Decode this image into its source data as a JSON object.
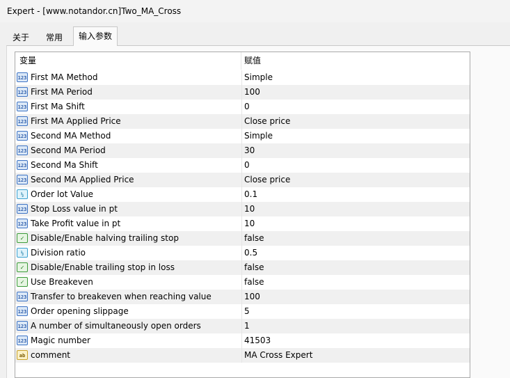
{
  "window": {
    "title": "Expert - [www.notandor.cn]Two_MA_Cross"
  },
  "tabs": [
    {
      "label": "关于",
      "active": false
    },
    {
      "label": "常用",
      "active": false
    },
    {
      "label": "输入参数",
      "active": true
    }
  ],
  "grid": {
    "headers": {
      "variable": "变量",
      "value": "赋值"
    },
    "rows": [
      {
        "icon": "num",
        "icon_text": "123",
        "name": "First MA Method",
        "value": "Simple"
      },
      {
        "icon": "num",
        "icon_text": "123",
        "name": "First MA Period",
        "value": "100"
      },
      {
        "icon": "num",
        "icon_text": "123",
        "name": "First Ma Shift",
        "value": "0"
      },
      {
        "icon": "num",
        "icon_text": "123",
        "name": "First MA Applied Price",
        "value": "Close price"
      },
      {
        "icon": "num",
        "icon_text": "123",
        "name": "Second MA Method",
        "value": "Simple"
      },
      {
        "icon": "num",
        "icon_text": "123",
        "name": "Second MA Period",
        "value": "30"
      },
      {
        "icon": "num",
        "icon_text": "123",
        "name": "Second Ma Shift",
        "value": "0"
      },
      {
        "icon": "num",
        "icon_text": "123",
        "name": "Second MA Applied Price",
        "value": "Close price"
      },
      {
        "icon": "dbl",
        "icon_text": "½",
        "name": "Order lot Value",
        "value": "0.1"
      },
      {
        "icon": "num",
        "icon_text": "123",
        "name": "Stop Loss value in pt",
        "value": "10"
      },
      {
        "icon": "num",
        "icon_text": "123",
        "name": "Take Profit value in pt",
        "value": "10"
      },
      {
        "icon": "bool",
        "icon_text": "✓",
        "name": "Disable/Enable halving trailing stop",
        "value": "false"
      },
      {
        "icon": "dbl",
        "icon_text": "½",
        "name": "Division ratio",
        "value": "0.5"
      },
      {
        "icon": "bool",
        "icon_text": "✓",
        "name": "Disable/Enable trailing stop in loss",
        "value": "false"
      },
      {
        "icon": "bool",
        "icon_text": "✓",
        "name": "Use Breakeven",
        "value": "false"
      },
      {
        "icon": "num",
        "icon_text": "123",
        "name": "Transfer to breakeven when reaching value",
        "value": "100"
      },
      {
        "icon": "num",
        "icon_text": "123",
        "name": "Order opening slippage",
        "value": "5"
      },
      {
        "icon": "num",
        "icon_text": "123",
        "name": "A number of simultaneously open orders",
        "value": "1"
      },
      {
        "icon": "num",
        "icon_text": "123",
        "name": "Magic number",
        "value": "41503"
      },
      {
        "icon": "str",
        "icon_text": "ab",
        "name": "comment",
        "value": "MA Cross Expert"
      }
    ]
  }
}
